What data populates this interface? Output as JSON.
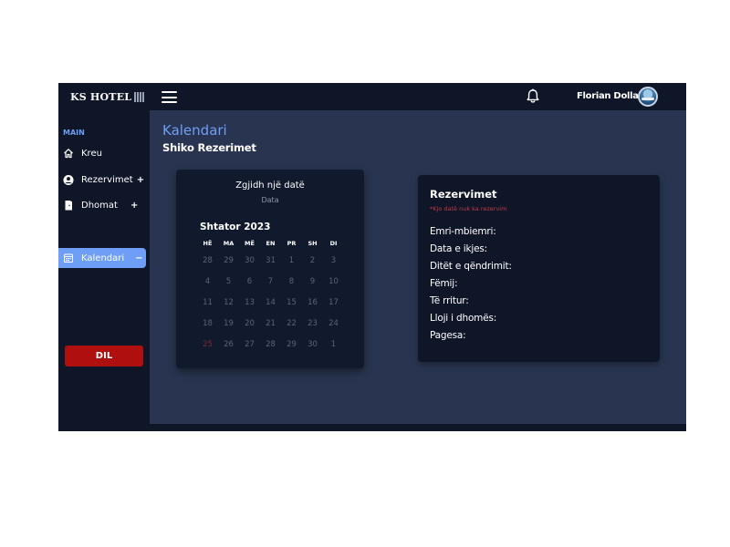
{
  "brand": {
    "name": "KS HOTEL"
  },
  "header": {
    "user_name": "Florian Dollani"
  },
  "sidebar": {
    "section_label": "MAIN",
    "items": [
      {
        "label": "Kreu",
        "icon": "home-icon",
        "sign": ""
      },
      {
        "label": "Rezervimet",
        "icon": "user-circle-icon",
        "sign": "+"
      },
      {
        "label": "Dhomat",
        "icon": "door-icon",
        "sign": "+"
      },
      {
        "label": "Kalendari",
        "icon": "calendar-icon",
        "sign": "−",
        "active": true
      }
    ],
    "logout_label": "DIL"
  },
  "page": {
    "title": "Kalendari",
    "subtitle": "Shiko Rezerimet"
  },
  "calendar": {
    "heading": "Zgjidh një datë",
    "field_label": "Data",
    "month_label": "Shtator 2023",
    "weekdays": [
      "HË",
      "MA",
      "MË",
      "EN",
      "PR",
      "SH",
      "DI"
    ],
    "weeks": [
      [
        "28",
        "29",
        "30",
        "31",
        "1",
        "2",
        "3"
      ],
      [
        "4",
        "5",
        "6",
        "7",
        "8",
        "9",
        "10"
      ],
      [
        "11",
        "12",
        "13",
        "14",
        "15",
        "16",
        "17"
      ],
      [
        "18",
        "19",
        "20",
        "21",
        "22",
        "23",
        "24"
      ],
      [
        "25",
        "26",
        "27",
        "28",
        "29",
        "30",
        "1"
      ]
    ],
    "highlighted_day": "25"
  },
  "reservations": {
    "title": "Rezervimet",
    "note": "*Kjo datë nuk ka rezervim",
    "fields": [
      "Emri-mbiemri:",
      "Data e ikjes:",
      "Ditët e qëndrimit:",
      "Fëmij:",
      "Të rritur:",
      "Lloji i dhomës:",
      "Pagesa:"
    ]
  },
  "colors": {
    "accent": "#6e9ef5",
    "sidebar_bg": "#0e1628",
    "content_bg": "#293550",
    "logout": "#b00f0f",
    "warning_text": "#c33a45"
  }
}
